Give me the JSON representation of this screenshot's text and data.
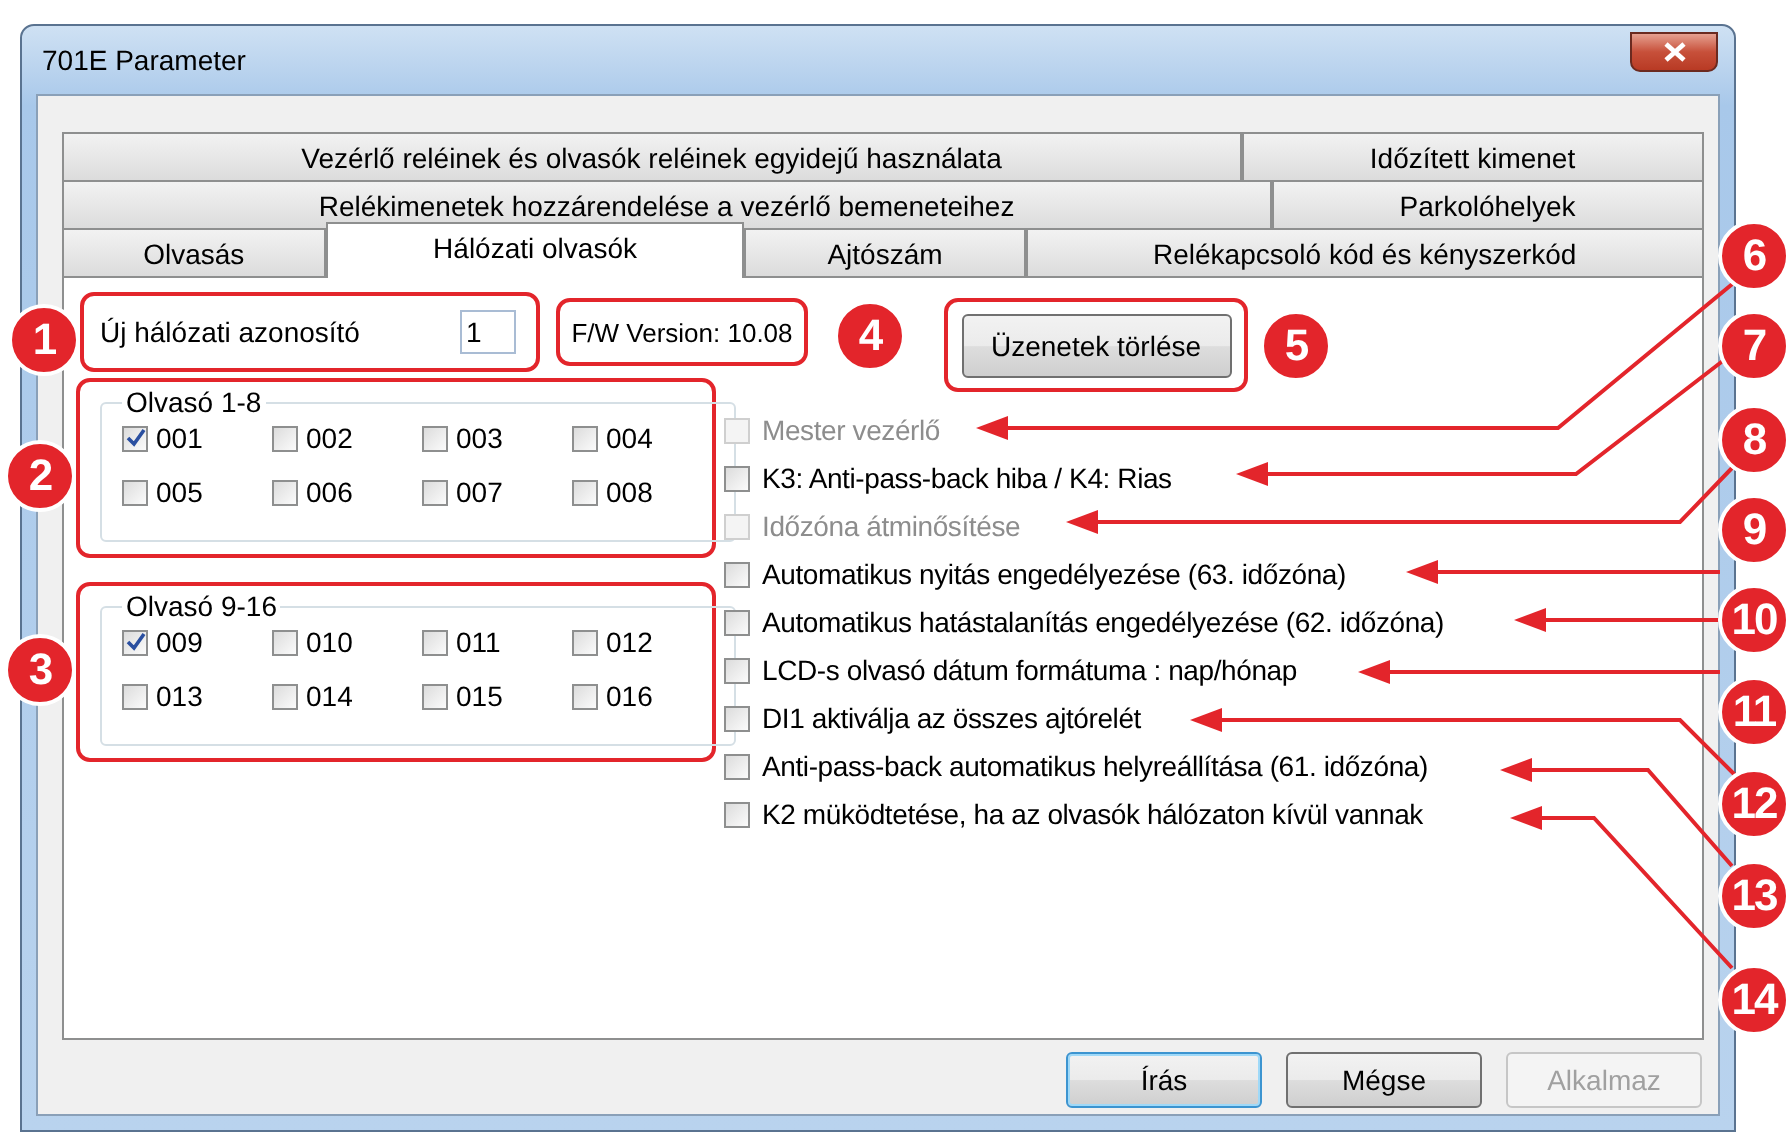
{
  "window": {
    "title": "701E Parameter"
  },
  "tab_rows": [
    [
      {
        "label": "Vezérlő reléinek és olvasók reléinek egyidejű használata",
        "selected": false
      },
      {
        "label": "Időzített kimenet",
        "selected": false
      }
    ],
    [
      {
        "label": "Relékimenetek hozzárendelése a vezérlő bemeneteihez",
        "selected": false
      },
      {
        "label": "Parkolóhelyek",
        "selected": false
      }
    ],
    [
      {
        "label": "Olvasás",
        "selected": false
      },
      {
        "label": "Hálózati olvasók",
        "selected": true
      },
      {
        "label": "Ajtószám",
        "selected": false
      },
      {
        "label": "Relékapcsoló kód és kényszerkód",
        "selected": false
      }
    ]
  ],
  "network_id": {
    "label": "Új hálózati azonosító",
    "value": "1"
  },
  "firmware": "F/W Version: 10.08",
  "clear_button": "Üzenetek törlése",
  "reader_groups": [
    {
      "title": "Olvasó 1-8",
      "readers": [
        {
          "label": "001",
          "checked": true
        },
        {
          "label": "002",
          "checked": false
        },
        {
          "label": "003",
          "checked": false
        },
        {
          "label": "004",
          "checked": false
        },
        {
          "label": "005",
          "checked": false
        },
        {
          "label": "006",
          "checked": false
        },
        {
          "label": "007",
          "checked": false
        },
        {
          "label": "008",
          "checked": false
        }
      ]
    },
    {
      "title": "Olvasó 9-16",
      "readers": [
        {
          "label": "009",
          "checked": true
        },
        {
          "label": "010",
          "checked": false
        },
        {
          "label": "011",
          "checked": false
        },
        {
          "label": "012",
          "checked": false
        },
        {
          "label": "013",
          "checked": false
        },
        {
          "label": "014",
          "checked": false
        },
        {
          "label": "015",
          "checked": false
        },
        {
          "label": "016",
          "checked": false
        }
      ]
    }
  ],
  "options": [
    {
      "label": "Mester vezérlő",
      "checked": false,
      "disabled": true
    },
    {
      "label": "K3: Anti-pass-back hiba / K4: Rias",
      "checked": false,
      "disabled": false
    },
    {
      "label": "Időzóna átminősítése",
      "checked": false,
      "disabled": true
    },
    {
      "label": "Automatikus nyitás engedélyezése (63. időzóna)",
      "checked": false,
      "disabled": false
    },
    {
      "label": "Automatikus hatástalanítás engedélyezése (62. időzóna)",
      "checked": false,
      "disabled": false
    },
    {
      "label": "LCD-s olvasó dátum formátuma : nap/hónap",
      "checked": false,
      "disabled": false
    },
    {
      "label": "DI1 aktiválja az összes ajtórelét",
      "checked": false,
      "disabled": false
    },
    {
      "label": "Anti-pass-back automatikus helyreállítása (61. időzóna)",
      "checked": false,
      "disabled": false
    },
    {
      "label": "K2 müködtetése, ha az olvasók hálózaton kívül vannak",
      "checked": false,
      "disabled": false
    }
  ],
  "buttons": [
    {
      "label": "Írás",
      "default": true,
      "disabled": false
    },
    {
      "label": "Mégse",
      "default": false,
      "disabled": false
    },
    {
      "label": "Alkalmaz",
      "default": false,
      "disabled": true
    }
  ],
  "callouts": [
    {
      "number": "1"
    },
    {
      "number": "2"
    },
    {
      "number": "3"
    },
    {
      "number": "4"
    },
    {
      "number": "5"
    },
    {
      "number": "6"
    },
    {
      "number": "7"
    },
    {
      "number": "8"
    },
    {
      "number": "9"
    },
    {
      "number": "10"
    },
    {
      "number": "11"
    },
    {
      "number": "12"
    },
    {
      "number": "13"
    },
    {
      "number": "14"
    }
  ]
}
